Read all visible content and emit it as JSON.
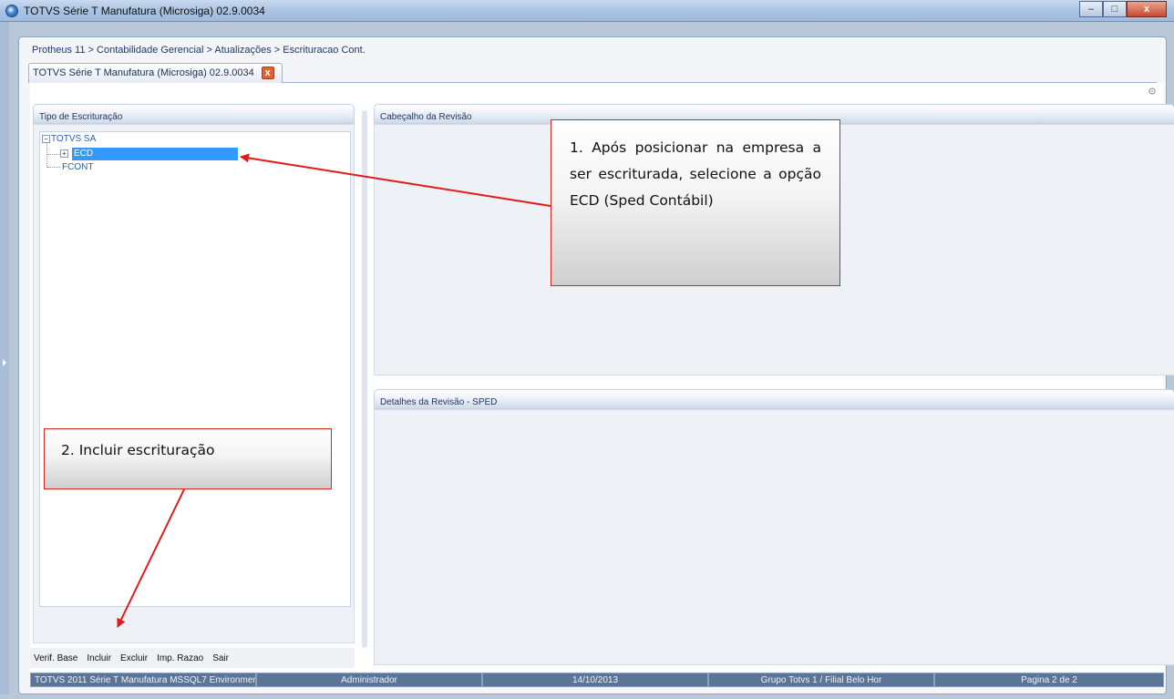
{
  "window": {
    "title": "TOTVS Série T Manufatura (Microsiga) 02.9.0034",
    "controls": {
      "minimize": "–",
      "maximize": "□",
      "close": "x"
    }
  },
  "breadcrumb": "Protheus 11 > Contabilidade Gerencial > Atualizações > Escrituracao Cont.",
  "tab": {
    "label": "TOTVS Série T Manufatura (Microsiga) 02.9.0034",
    "close": "x"
  },
  "panels": {
    "tipo_escrituracao": {
      "title": "Tipo de Escrituração",
      "tree": {
        "root": "TOTVS SA",
        "children": [
          "ECD",
          "FCONT"
        ],
        "selected": "ECD"
      },
      "toolbar": [
        "Verif. Base",
        "Incluir",
        "Excluir",
        "Imp. Razao",
        "Sair"
      ]
    },
    "cabecalho": {
      "title": "Cabeçalho da Revisão"
    },
    "detalhes": {
      "title": "Detalhes da Revisão - SPED"
    }
  },
  "statusbar": [
    "TOTVS 2011 Série T Manufatura MSSQL7 Environment",
    "Administrador",
    "14/10/2013",
    "Grupo Totvs 1 / Filial Belo Hor",
    "Pagina 2 de 2"
  ],
  "annotations": {
    "callout_1": "1. Após posicionar na empresa a ser escriturada, selecione a opção ECD (Sped Contábil)",
    "callout_2": "2. Incluir escrituração",
    "color": "#e01b1b"
  },
  "icons": [
    "app-icon",
    "close-icon",
    "settings-icon",
    "tree-expand-icon"
  ]
}
